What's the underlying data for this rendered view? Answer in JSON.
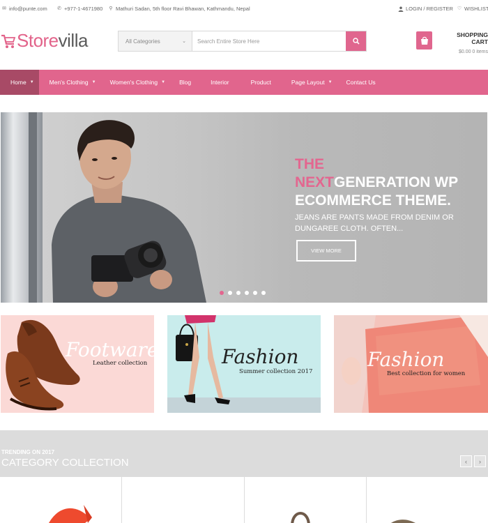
{
  "topbar": {
    "email": "info@punte.com",
    "phone": "+977-1-4671980",
    "address": "Mathuri Sadan, 5th floor Ravi Bhawan, Kathmandu, Nepal",
    "login": "LOGIN / REGISTER",
    "wishlist": "WISHLIST"
  },
  "logo": {
    "part1": "Store",
    "part2": "villa"
  },
  "search": {
    "category": "All Categories",
    "placeholder": "Search Entire Store Here"
  },
  "cart": {
    "title": "SHOPPING CART",
    "summary": "$0.00 0 items"
  },
  "nav": {
    "items": [
      {
        "label": "Home"
      },
      {
        "label": "Men's Clothing"
      },
      {
        "label": "Women's Clothing"
      },
      {
        "label": "Blog"
      },
      {
        "label": "Interior"
      },
      {
        "label": "Product"
      },
      {
        "label": "Page Layout"
      },
      {
        "label": "Contact Us"
      }
    ]
  },
  "hero": {
    "title_pink": "THE",
    "title_pink2": "NEXT",
    "title_white1": "GENERATION WP",
    "title_white2": "ECOMMERCE THEME.",
    "description": "JEANS ARE PANTS MADE FROM DENIM OR DUNGAREE CLOTH. OFTEN...",
    "button": "VIEW MORE",
    "slide_count": 6,
    "active_slide": 1
  },
  "banners": [
    {
      "script": "Footware",
      "subtitle": "Leather collection"
    },
    {
      "script": "Fashion",
      "subtitle": "Summer collection 2017"
    },
    {
      "script": "Fashion",
      "subtitle": "Best collection for women"
    }
  ],
  "category": {
    "kicker": "TRENDING ON 2017",
    "title": "CATEGORY COLLECTION"
  },
  "colors": {
    "brand": "#e1658d",
    "nav_active": "#a84a66"
  }
}
